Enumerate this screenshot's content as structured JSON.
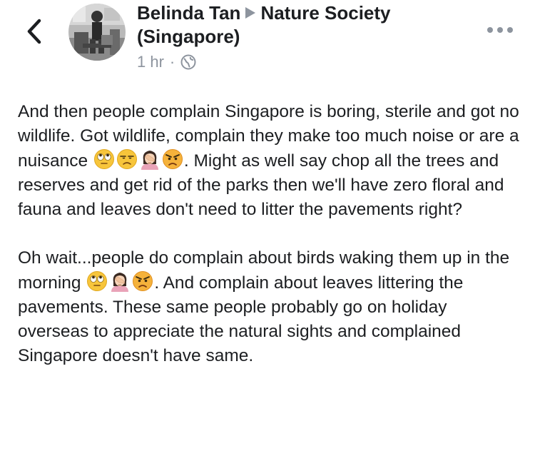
{
  "post": {
    "author": "Belinda Tan",
    "group": "Nature Society (Singapore)",
    "time": "1 hr",
    "separator": "·",
    "privacy_icon": "globe-icon",
    "paragraph1": {
      "part1": "And then people complain Singapore is boring, sterile and got no wildlife. Got wildlife, complain they make too much noise or are a nuisance ",
      "emojis": [
        "face-with-rolling-eyes",
        "unamused-face",
        "person-facepalming",
        "angry-face"
      ],
      "part2": ". Might as well say chop all the trees and reserves and get rid of the parks then we'll have zero floral and fauna and leaves don't need to litter the pavements right?"
    },
    "paragraph2": {
      "part1": "Oh wait...people do complain about birds waking them up in the morning ",
      "emojis": [
        "face-with-rolling-eyes",
        "person-facepalming",
        "angry-face"
      ],
      "part2": ". And complain about leaves littering the pavements. These same people probably go on holiday overseas to appreciate the natural sights and complained Singapore doesn't have same."
    }
  },
  "icons": {
    "back": "chevron-left-icon",
    "more": "more-options-icon",
    "arrow": "right-triangle-icon"
  },
  "colors": {
    "text": "#1c1e21",
    "meta": "#8d949e",
    "background": "#ffffff"
  }
}
